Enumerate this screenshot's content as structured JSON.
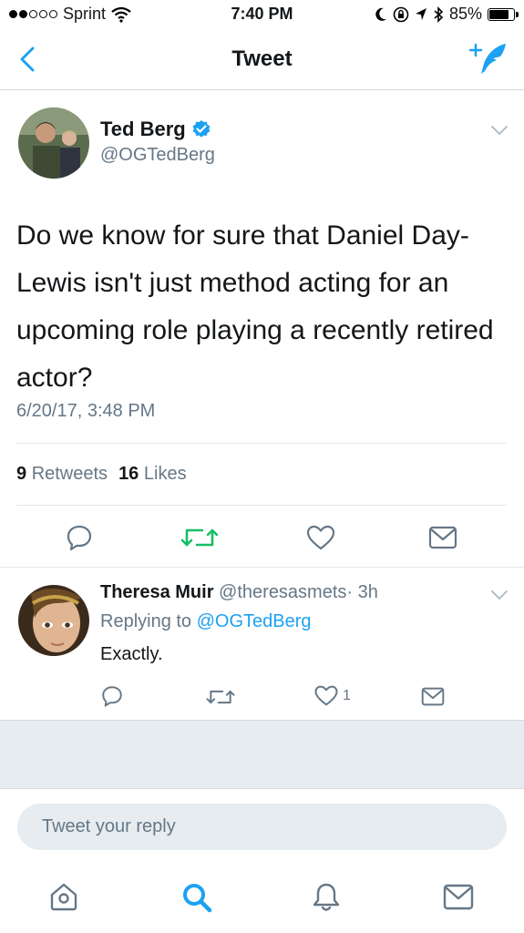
{
  "status_bar": {
    "carrier": "Sprint",
    "time": "7:40 PM",
    "battery": "85%",
    "battery_level": 0.85
  },
  "nav": {
    "title": "Tweet"
  },
  "tweet": {
    "author_name": "Ted Berg",
    "author_handle": "@OGTedBerg",
    "text": "Do we know for sure that Daniel Day-Lewis isn't just method acting for an upcoming role playing a recently retired actor?",
    "timestamp": "6/20/17, 3:48 PM",
    "retweet_count": "9",
    "retweet_label": "Retweets",
    "like_count": "16",
    "like_label": "Likes"
  },
  "reply": {
    "author_name": "Theresa Muir",
    "author_handle": "@theresasmets",
    "age": "· 3h",
    "replying_prefix": "Replying to",
    "replying_to": "@OGTedBerg",
    "text": "Exactly.",
    "like_count": "1"
  },
  "compose": {
    "placeholder": "Tweet your reply"
  },
  "colors": {
    "accent": "#1da1f2",
    "retweet_green": "#17bf63",
    "secondary_text": "#657786"
  }
}
